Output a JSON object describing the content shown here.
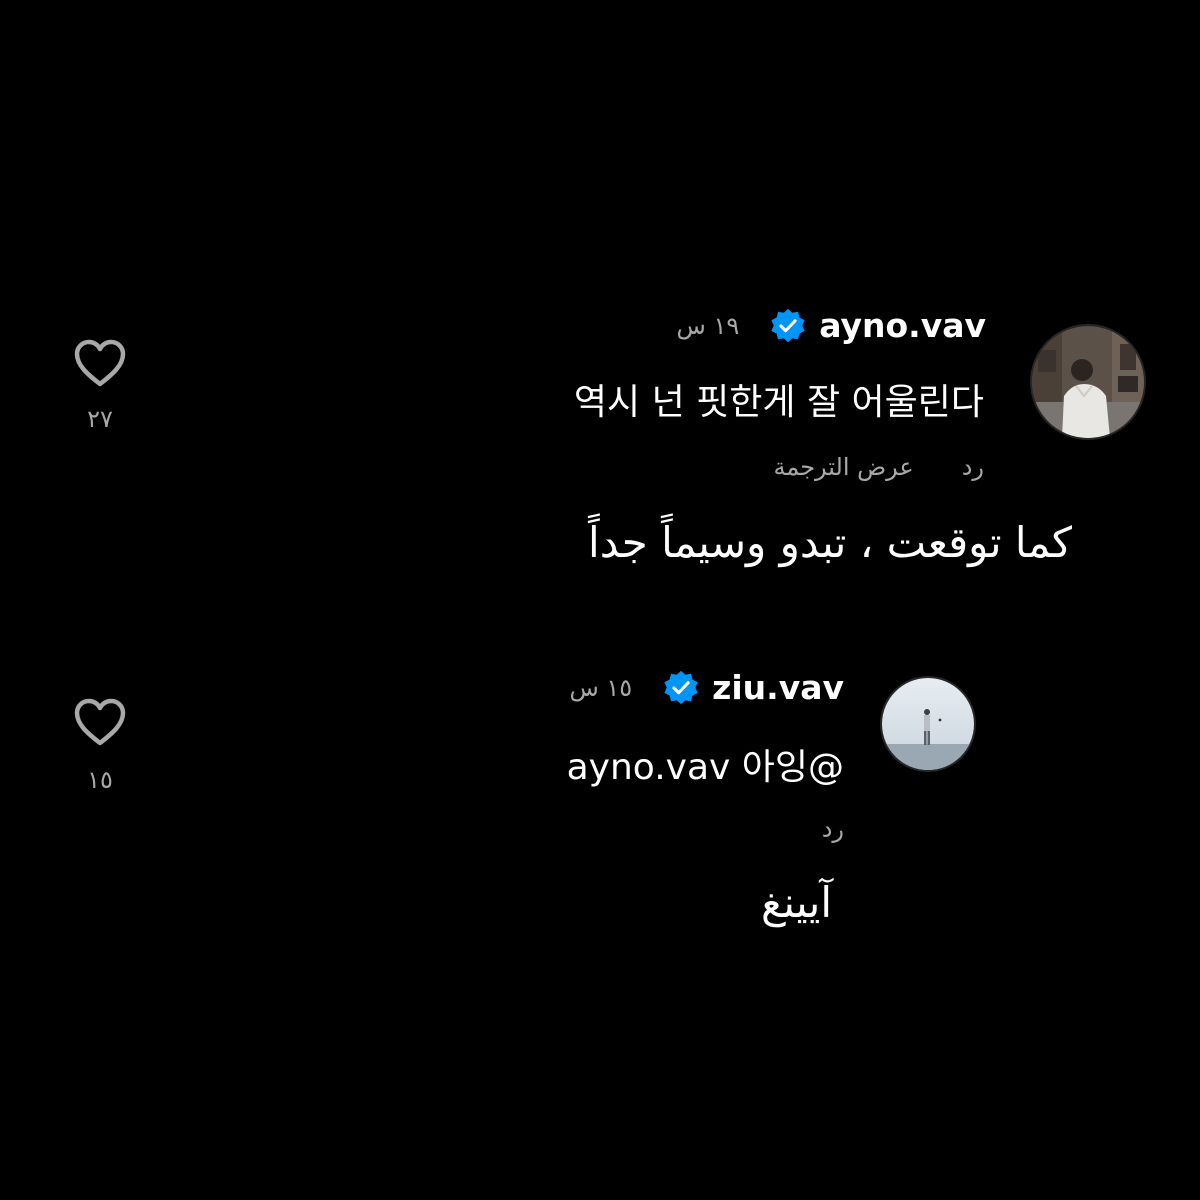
{
  "comments": [
    {
      "username": "ayno.vav",
      "time": "١٩ س",
      "text": "역시 넌 핏한게 잘 어울린다",
      "reply_label": "رد",
      "translate_label": "عرض الترجمة",
      "translation": "كما توقعت ، تبدو وسيماً جداً",
      "likes": "٢٧",
      "verified": true
    },
    {
      "username": "ziu.vav",
      "time": "١٥ س",
      "text": "ayno.vav 아잉@",
      "reply_label": "رد",
      "translation": "آيينغ",
      "likes": "١٥",
      "verified": true
    }
  ],
  "colors": {
    "background": "#000000",
    "text_primary": "#ffffff",
    "text_secondary": "#a8a8a8",
    "verified_badge": "#0095f6"
  },
  "icons": {
    "like": "heart-outline-icon",
    "verified": "verified-badge-icon"
  }
}
